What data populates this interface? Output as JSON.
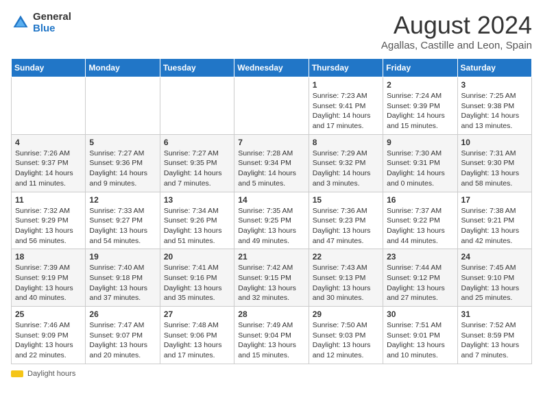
{
  "header": {
    "logo_general": "General",
    "logo_blue": "Blue",
    "month_title": "August 2024",
    "subtitle": "Agallas, Castille and Leon, Spain"
  },
  "days_of_week": [
    "Sunday",
    "Monday",
    "Tuesday",
    "Wednesday",
    "Thursday",
    "Friday",
    "Saturday"
  ],
  "weeks": [
    [
      {
        "day": null,
        "info": null
      },
      {
        "day": null,
        "info": null
      },
      {
        "day": null,
        "info": null
      },
      {
        "day": null,
        "info": null
      },
      {
        "day": "1",
        "info": "Sunrise: 7:23 AM\nSunset: 9:41 PM\nDaylight: 14 hours and 17 minutes."
      },
      {
        "day": "2",
        "info": "Sunrise: 7:24 AM\nSunset: 9:39 PM\nDaylight: 14 hours and 15 minutes."
      },
      {
        "day": "3",
        "info": "Sunrise: 7:25 AM\nSunset: 9:38 PM\nDaylight: 14 hours and 13 minutes."
      }
    ],
    [
      {
        "day": "4",
        "info": "Sunrise: 7:26 AM\nSunset: 9:37 PM\nDaylight: 14 hours and 11 minutes."
      },
      {
        "day": "5",
        "info": "Sunrise: 7:27 AM\nSunset: 9:36 PM\nDaylight: 14 hours and 9 minutes."
      },
      {
        "day": "6",
        "info": "Sunrise: 7:27 AM\nSunset: 9:35 PM\nDaylight: 14 hours and 7 minutes."
      },
      {
        "day": "7",
        "info": "Sunrise: 7:28 AM\nSunset: 9:34 PM\nDaylight: 14 hours and 5 minutes."
      },
      {
        "day": "8",
        "info": "Sunrise: 7:29 AM\nSunset: 9:32 PM\nDaylight: 14 hours and 3 minutes."
      },
      {
        "day": "9",
        "info": "Sunrise: 7:30 AM\nSunset: 9:31 PM\nDaylight: 14 hours and 0 minutes."
      },
      {
        "day": "10",
        "info": "Sunrise: 7:31 AM\nSunset: 9:30 PM\nDaylight: 13 hours and 58 minutes."
      }
    ],
    [
      {
        "day": "11",
        "info": "Sunrise: 7:32 AM\nSunset: 9:29 PM\nDaylight: 13 hours and 56 minutes."
      },
      {
        "day": "12",
        "info": "Sunrise: 7:33 AM\nSunset: 9:27 PM\nDaylight: 13 hours and 54 minutes."
      },
      {
        "day": "13",
        "info": "Sunrise: 7:34 AM\nSunset: 9:26 PM\nDaylight: 13 hours and 51 minutes."
      },
      {
        "day": "14",
        "info": "Sunrise: 7:35 AM\nSunset: 9:25 PM\nDaylight: 13 hours and 49 minutes."
      },
      {
        "day": "15",
        "info": "Sunrise: 7:36 AM\nSunset: 9:23 PM\nDaylight: 13 hours and 47 minutes."
      },
      {
        "day": "16",
        "info": "Sunrise: 7:37 AM\nSunset: 9:22 PM\nDaylight: 13 hours and 44 minutes."
      },
      {
        "day": "17",
        "info": "Sunrise: 7:38 AM\nSunset: 9:21 PM\nDaylight: 13 hours and 42 minutes."
      }
    ],
    [
      {
        "day": "18",
        "info": "Sunrise: 7:39 AM\nSunset: 9:19 PM\nDaylight: 13 hours and 40 minutes."
      },
      {
        "day": "19",
        "info": "Sunrise: 7:40 AM\nSunset: 9:18 PM\nDaylight: 13 hours and 37 minutes."
      },
      {
        "day": "20",
        "info": "Sunrise: 7:41 AM\nSunset: 9:16 PM\nDaylight: 13 hours and 35 minutes."
      },
      {
        "day": "21",
        "info": "Sunrise: 7:42 AM\nSunset: 9:15 PM\nDaylight: 13 hours and 32 minutes."
      },
      {
        "day": "22",
        "info": "Sunrise: 7:43 AM\nSunset: 9:13 PM\nDaylight: 13 hours and 30 minutes."
      },
      {
        "day": "23",
        "info": "Sunrise: 7:44 AM\nSunset: 9:12 PM\nDaylight: 13 hours and 27 minutes."
      },
      {
        "day": "24",
        "info": "Sunrise: 7:45 AM\nSunset: 9:10 PM\nDaylight: 13 hours and 25 minutes."
      }
    ],
    [
      {
        "day": "25",
        "info": "Sunrise: 7:46 AM\nSunset: 9:09 PM\nDaylight: 13 hours and 22 minutes."
      },
      {
        "day": "26",
        "info": "Sunrise: 7:47 AM\nSunset: 9:07 PM\nDaylight: 13 hours and 20 minutes."
      },
      {
        "day": "27",
        "info": "Sunrise: 7:48 AM\nSunset: 9:06 PM\nDaylight: 13 hours and 17 minutes."
      },
      {
        "day": "28",
        "info": "Sunrise: 7:49 AM\nSunset: 9:04 PM\nDaylight: 13 hours and 15 minutes."
      },
      {
        "day": "29",
        "info": "Sunrise: 7:50 AM\nSunset: 9:03 PM\nDaylight: 13 hours and 12 minutes."
      },
      {
        "day": "30",
        "info": "Sunrise: 7:51 AM\nSunset: 9:01 PM\nDaylight: 13 hours and 10 minutes."
      },
      {
        "day": "31",
        "info": "Sunrise: 7:52 AM\nSunset: 8:59 PM\nDaylight: 13 hours and 7 minutes."
      }
    ]
  ],
  "footer": {
    "daylight_label": "Daylight hours"
  }
}
